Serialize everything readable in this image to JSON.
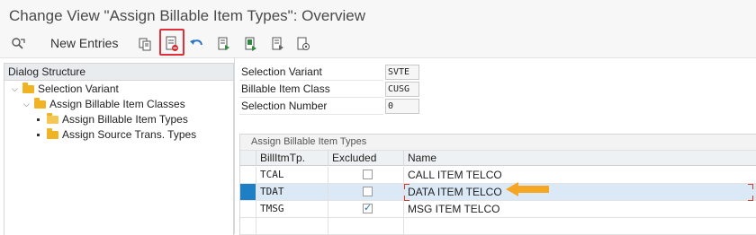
{
  "window": {
    "title": "Change View \"Assign Billable Item Types\": Overview"
  },
  "toolbar": {
    "new_entries_label": "New Entries",
    "icons": [
      "display-change-icon",
      "copy-icon",
      "delete-icon",
      "undo-icon",
      "select-all-icon",
      "select-block-icon",
      "deselect-all-icon",
      "config-icon"
    ]
  },
  "dialog_structure": {
    "header": "Dialog Structure",
    "items": [
      {
        "label": "Selection Variant",
        "level": 0,
        "expanded": true
      },
      {
        "label": "Assign Billable Item Classes",
        "level": 1,
        "expanded": true
      },
      {
        "label": "Assign Billable Item Types",
        "level": 2,
        "selected": true
      },
      {
        "label": "Assign Source Trans. Types",
        "level": 2
      }
    ]
  },
  "header_fields": [
    {
      "label": "Selection Variant",
      "value": "SVTE"
    },
    {
      "label": "Billable Item Class",
      "value": "CUSG"
    },
    {
      "label": "Selection Number",
      "value": "0"
    }
  ],
  "table": {
    "caption": "Assign Billable Item Types",
    "columns": [
      "BillItmTp.",
      "Excluded",
      "Name"
    ],
    "rows": [
      {
        "type": "TCAL",
        "excluded": false,
        "name": "CALL ITEM TELCO"
      },
      {
        "type": "TDAT",
        "excluded": false,
        "name": "DATA ITEM TELCO",
        "selected": true
      },
      {
        "type": "TMSG",
        "excluded": true,
        "name": "MSG ITEM TELCO"
      }
    ]
  },
  "colors": {
    "highlight": "#e0303a",
    "folder": "#f0b323",
    "selection": "#1f7fc4",
    "arrow": "#f5a623"
  }
}
